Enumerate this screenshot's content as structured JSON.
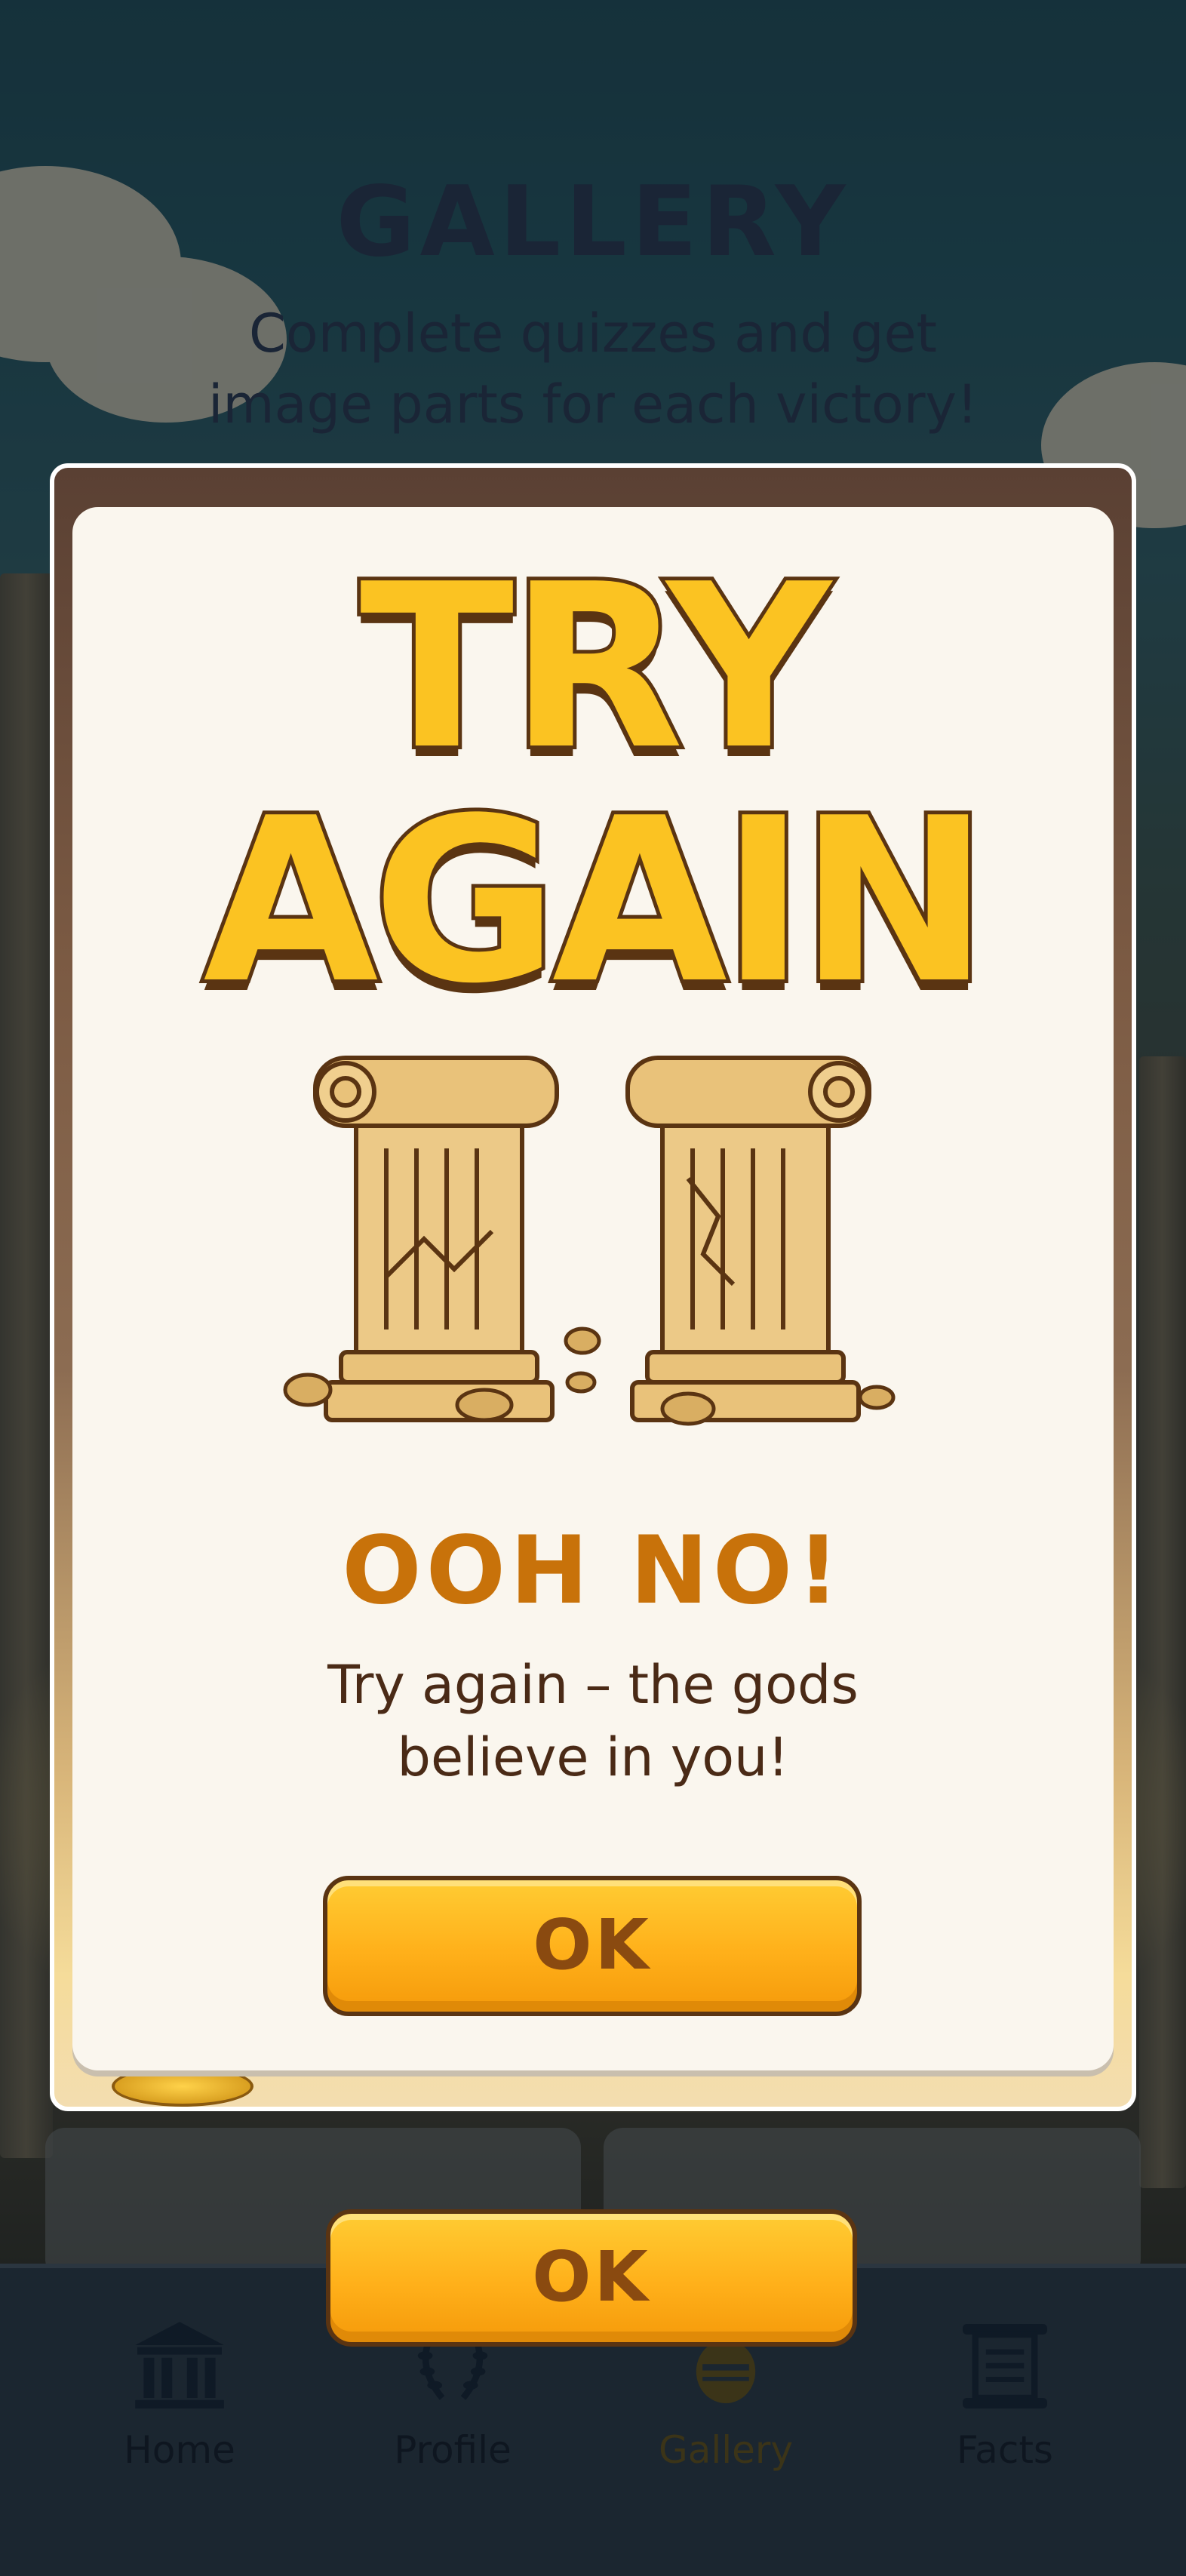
{
  "gallery": {
    "title": "GALLERY",
    "subtitle": "Complete quizzes and get image parts for each victory!"
  },
  "modal": {
    "title_line1": "TRY",
    "title_line2": "AGAIN",
    "image_icon": "broken-columns",
    "heading": "OOH NO!",
    "message": "Try again – the gods believe in you!",
    "ok_label": "OK"
  },
  "bottom_button": {
    "label": "OK"
  },
  "nav": {
    "items": [
      {
        "label": "Home",
        "icon": "temple-icon",
        "active": false
      },
      {
        "label": "Profile",
        "icon": "laurel-icon",
        "active": false
      },
      {
        "label": "Gallery",
        "icon": "amphora-icon",
        "active": true
      },
      {
        "label": "Facts",
        "icon": "scroll-icon",
        "active": false
      }
    ]
  },
  "colors": {
    "title_yellow": "#fbc322",
    "title_outline": "#5a3412",
    "heading_orange": "#c8720a",
    "button_orange": "#ffb01a",
    "card_bg": "#faf6ee"
  }
}
